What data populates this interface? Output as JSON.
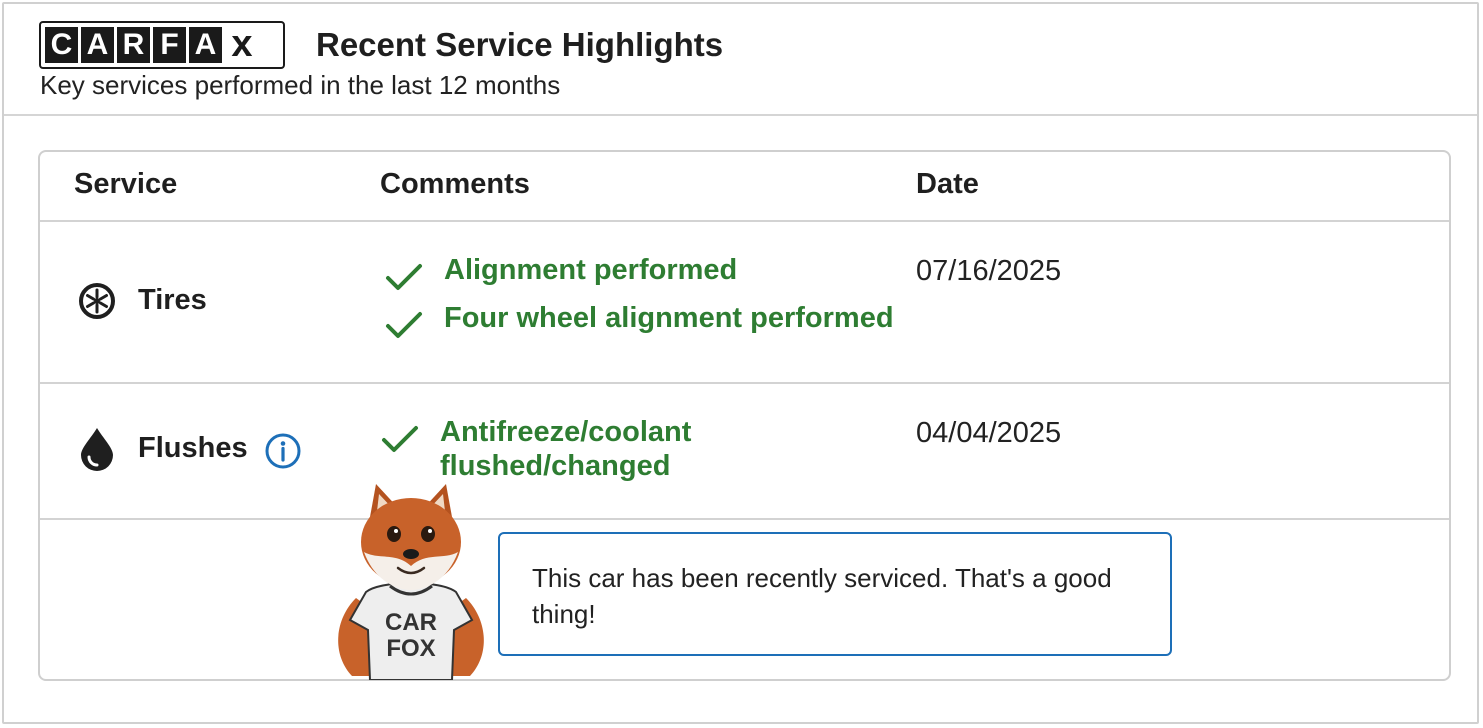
{
  "logo": {
    "letters": [
      "C",
      "A",
      "R",
      "F",
      "A",
      "x"
    ]
  },
  "header": {
    "title": "Recent Service Highlights",
    "subtitle": "Key services performed in the last 12 months"
  },
  "table": {
    "columns": [
      "Service",
      "Comments",
      "Date"
    ],
    "rows": [
      {
        "service": "Tires",
        "icon": "tire-icon",
        "comments": [
          "Alignment performed",
          "Four wheel alignment performed"
        ],
        "date": "07/16/2025"
      },
      {
        "service": "Flushes",
        "icon": "droplet-icon",
        "comments": [
          "Antifreeze/coolant flushed/changed"
        ],
        "date": "04/04/2025"
      }
    ]
  },
  "mascot": {
    "shirt_line1": "CAR",
    "shirt_line2": "FOX"
  },
  "message": "This car has been recently serviced. That's a good thing!",
  "colors": {
    "accent_green": "#2e7d32",
    "info_blue": "#1d6fb8",
    "border_gray": "#cfcfcf"
  }
}
